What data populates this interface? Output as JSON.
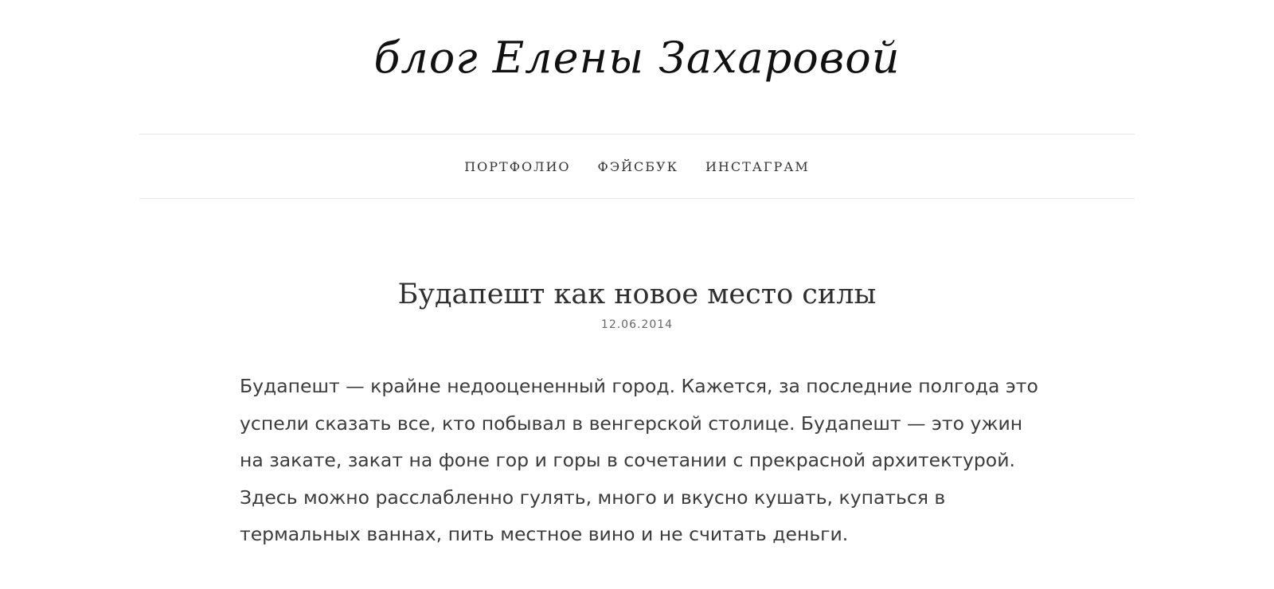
{
  "header": {
    "logo_text": "блог Елены Захаровой"
  },
  "nav": {
    "items": [
      {
        "label": "ПОРТФОЛИО"
      },
      {
        "label": "ФЭЙСБУК"
      },
      {
        "label": "ИНСТАГРАМ"
      }
    ]
  },
  "post": {
    "title": "Будапешт как новое место силы",
    "date": "12.06.2014",
    "body": "Будапешт — крайне недооцененный город. Кажется, за последние полгода это успели сказать все, кто побывал в венгерской столице. Будапешт — это ужин на закате, закат на фоне гор и горы в сочетании с прекрасной архитектурой. Здесь можно расслабленно гулять, много и вкусно кушать, купаться в термальных ваннах, пить местное вино и не считать деньги."
  }
}
